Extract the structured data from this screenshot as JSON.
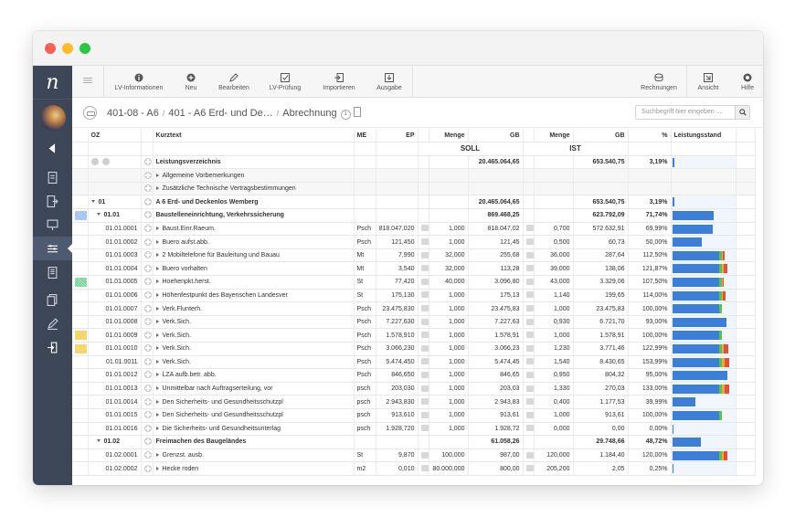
{
  "app_logo": "n",
  "toolbar": {
    "items": [
      "LV-Informationen",
      "Neu",
      "Bearbeiten",
      "LV-Prüfung",
      "Importieren",
      "Ausgabe"
    ],
    "right_items": [
      "Rechnungen",
      "Ansicht",
      "Hilfe"
    ],
    "notification_count": "3"
  },
  "breadcrumb": {
    "parts": [
      "401-08 - A6",
      "401 - A6 Erd- und De…",
      "Abrechnung"
    ],
    "count": "1"
  },
  "search": {
    "placeholder": "Suchbegriff hier eingeben ..."
  },
  "columns": {
    "oz": "OZ",
    "kurztext": "Kurztext",
    "me": "ME",
    "ep": "EP",
    "soll_menge": "Menge",
    "soll_gb": "GB",
    "ist_menge": "Menge",
    "ist_gb": "GB",
    "pct": "%",
    "leistungsstand": "Leistungsstand",
    "soll": "SOLL",
    "ist": "IST"
  },
  "colors": {
    "bar_blue": "#3b7fd9",
    "bar_green": "#58c24e",
    "bar_red": "#e0503a",
    "bar_orange": "#f2a63b",
    "sidebar": "#3d4656"
  },
  "rows": [
    {
      "type": "root",
      "oz": "",
      "text": "Leistungsverzeichnis",
      "me": "",
      "ep": "",
      "sm": "",
      "sgb": "20.465.064,65",
      "im": "",
      "igb": "653.540,75",
      "pct": "3,19%",
      "fill": 0.032,
      "bold": true
    },
    {
      "type": "info",
      "oz": "",
      "text": "Allgemeine Vorbemerkungen",
      "me": "",
      "ep": "",
      "sm": "",
      "sgb": "",
      "im": "",
      "igb": "",
      "pct": "",
      "fill": null,
      "grey": true
    },
    {
      "type": "info",
      "oz": "",
      "text": "Zusätzliche Technische Vertragsbestimmungen",
      "me": "",
      "ep": "",
      "sm": "",
      "sgb": "",
      "im": "",
      "igb": "",
      "pct": "",
      "fill": null,
      "grey": true
    },
    {
      "type": "group",
      "oz": "01",
      "text": "A 6 Erd- und Deckenlos Wemberg",
      "me": "",
      "ep": "",
      "sm": "",
      "sgb": "20.465.064,65",
      "im": "",
      "igb": "653.540,75",
      "pct": "3,19%",
      "fill": 0.032,
      "bold": true,
      "level": 0
    },
    {
      "type": "group",
      "oz": "01.01",
      "text": "Baustelleneinrichtung, Verkehrssicherung",
      "me": "",
      "ep": "",
      "sm": "",
      "sgb": "869.468,25",
      "im": "",
      "igb": "623.792,09",
      "pct": "71,74%",
      "fill": 0.717,
      "bold": true,
      "level": 1,
      "marker": "blue"
    },
    {
      "type": "item",
      "oz": "01.01.0001",
      "text": "Baust.Einr.Raeum.",
      "me": "Psch",
      "ep": "818.047,020",
      "sm": "1,000",
      "sgb": "818.047,02",
      "im": "0,700",
      "igb": "572.632,91",
      "pct": "69,99%",
      "fill": 0.7
    },
    {
      "type": "item",
      "oz": "01.01.0002",
      "text": "Buero aufst.abb.",
      "me": "Psch",
      "ep": "121,450",
      "sm": "1,000",
      "sgb": "121,45",
      "im": "0,500",
      "igb": "60,73",
      "pct": "50,00%",
      "fill": 0.5
    },
    {
      "type": "item",
      "oz": "01.01.0003",
      "text": "2 Mobiltelefone für Bauleitung und Bauau",
      "me": "Mt",
      "ep": "7,990",
      "sm": "32,000",
      "sgb": "255,68",
      "im": "36,000",
      "igb": "287,64",
      "pct": "112,50%",
      "fill": 1.125
    },
    {
      "type": "item",
      "oz": "01.01.0004",
      "text": "Buero vorhalten",
      "me": "Mt",
      "ep": "3,540",
      "sm": "32,000",
      "sgb": "113,28",
      "im": "39,000",
      "igb": "138,06",
      "pct": "121,87%",
      "fill": 1.219
    },
    {
      "type": "item",
      "oz": "01.01.0005",
      "text": "Hoehenpkt.herst.",
      "me": "St",
      "ep": "77,420",
      "sm": "40,000",
      "sgb": "3.096,80",
      "im": "43,000",
      "igb": "3.329,06",
      "pct": "107,50%",
      "fill": 1.075,
      "marker": "green"
    },
    {
      "type": "item",
      "oz": "01.01.0006",
      "text": "Höhenfestpunkt des Bayerischen Landesver",
      "me": "St",
      "ep": "175,130",
      "sm": "1,000",
      "sgb": "175,13",
      "im": "1,140",
      "igb": "199,65",
      "pct": "114,00%",
      "fill": 1.14
    },
    {
      "type": "item",
      "oz": "01.01.0007",
      "text": "Verk.Flunterh.",
      "me": "Psch",
      "ep": "23.475,830",
      "sm": "1,000",
      "sgb": "23.475,83",
      "im": "1,000",
      "igb": "23.475,83",
      "pct": "100,00%",
      "fill": 1.0
    },
    {
      "type": "item",
      "oz": "01.01.0008",
      "text": "Verk.Sich.",
      "me": "Psch",
      "ep": "7.227,630",
      "sm": "1,000",
      "sgb": "7.227,63",
      "im": "0,930",
      "igb": "6.721,70",
      "pct": "93,00%",
      "fill": 0.93
    },
    {
      "type": "item",
      "oz": "01.01.0009",
      "text": "Verk.Sich.",
      "me": "Psch",
      "ep": "1.578,910",
      "sm": "1,000",
      "sgb": "1.578,91",
      "im": "1,000",
      "igb": "1.578,91",
      "pct": "100,00%",
      "fill": 1.0,
      "marker": "yellow"
    },
    {
      "type": "item",
      "oz": "01.01.0010",
      "text": "Verk.Sich.",
      "me": "Psch",
      "ep": "3.066,230",
      "sm": "1,000",
      "sgb": "3.066,23",
      "im": "1,230",
      "igb": "3.771,46",
      "pct": "122,99%",
      "fill": 1.23,
      "marker": "yellow"
    },
    {
      "type": "item",
      "oz": "01.01.0011",
      "text": "Verk.Sich.",
      "me": "Psch",
      "ep": "5.474,450",
      "sm": "1,000",
      "sgb": "5.474,45",
      "im": "1,540",
      "igb": "8.430,65",
      "pct": "153,99%",
      "fill": 1.54
    },
    {
      "type": "item",
      "oz": "01.01.0012",
      "text": "LZA aufb.betr. abb.",
      "me": "Psch",
      "ep": "846,650",
      "sm": "1,000",
      "sgb": "846,65",
      "im": "0,950",
      "igb": "804,32",
      "pct": "95,00%",
      "fill": 0.95
    },
    {
      "type": "item",
      "oz": "01.01.0013",
      "text": "Unmittelbar nach Auftragserteilung, vor",
      "me": "psch",
      "ep": "203,030",
      "sm": "1,000",
      "sgb": "203,03",
      "im": "1,330",
      "igb": "270,03",
      "pct": "133,00%",
      "fill": 1.33
    },
    {
      "type": "item",
      "oz": "01.01.0014",
      "text": "Den Sicherheits- und Gesundheitsschutzpl",
      "me": "psch",
      "ep": "2.943,830",
      "sm": "1,000",
      "sgb": "2.943,83",
      "im": "0,400",
      "igb": "1.177,53",
      "pct": "39,99%",
      "fill": 0.4
    },
    {
      "type": "item",
      "oz": "01.01.0015",
      "text": "Den Sicherheits- und Gesundheitsschutzpl",
      "me": "psch",
      "ep": "913,610",
      "sm": "1,000",
      "sgb": "913,61",
      "im": "1,000",
      "igb": "913,61",
      "pct": "100,00%",
      "fill": 1.0
    },
    {
      "type": "item",
      "oz": "01.01.0016",
      "text": "Die Sicherheits- und Gesundheitsunterlag",
      "me": "psch",
      "ep": "1.928,720",
      "sm": "1,000",
      "sgb": "1.928,72",
      "im": "0,000",
      "igb": "0,00",
      "pct": "0,00%",
      "fill": 0.0
    },
    {
      "type": "group",
      "oz": "01.02",
      "text": "Freimachen des Baugeländes",
      "me": "",
      "ep": "",
      "sm": "",
      "sgb": "61.058,26",
      "im": "",
      "igb": "29.748,66",
      "pct": "48,72%",
      "fill": 0.487,
      "bold": true,
      "level": 1
    },
    {
      "type": "item",
      "oz": "01.02.0001",
      "text": "Grenzst. ausb.",
      "me": "St",
      "ep": "9,870",
      "sm": "100,000",
      "sgb": "987,00",
      "im": "120,000",
      "igb": "1.184,40",
      "pct": "120,00%",
      "fill": 1.2
    },
    {
      "type": "item",
      "oz": "01.02.0002",
      "text": "Hecke roden",
      "me": "m2",
      "ep": "0,010",
      "sm": "80.000,000",
      "sgb": "800,00",
      "im": "205,200",
      "igb": "2,05",
      "pct": "0,25%",
      "fill": 0.0025
    }
  ]
}
